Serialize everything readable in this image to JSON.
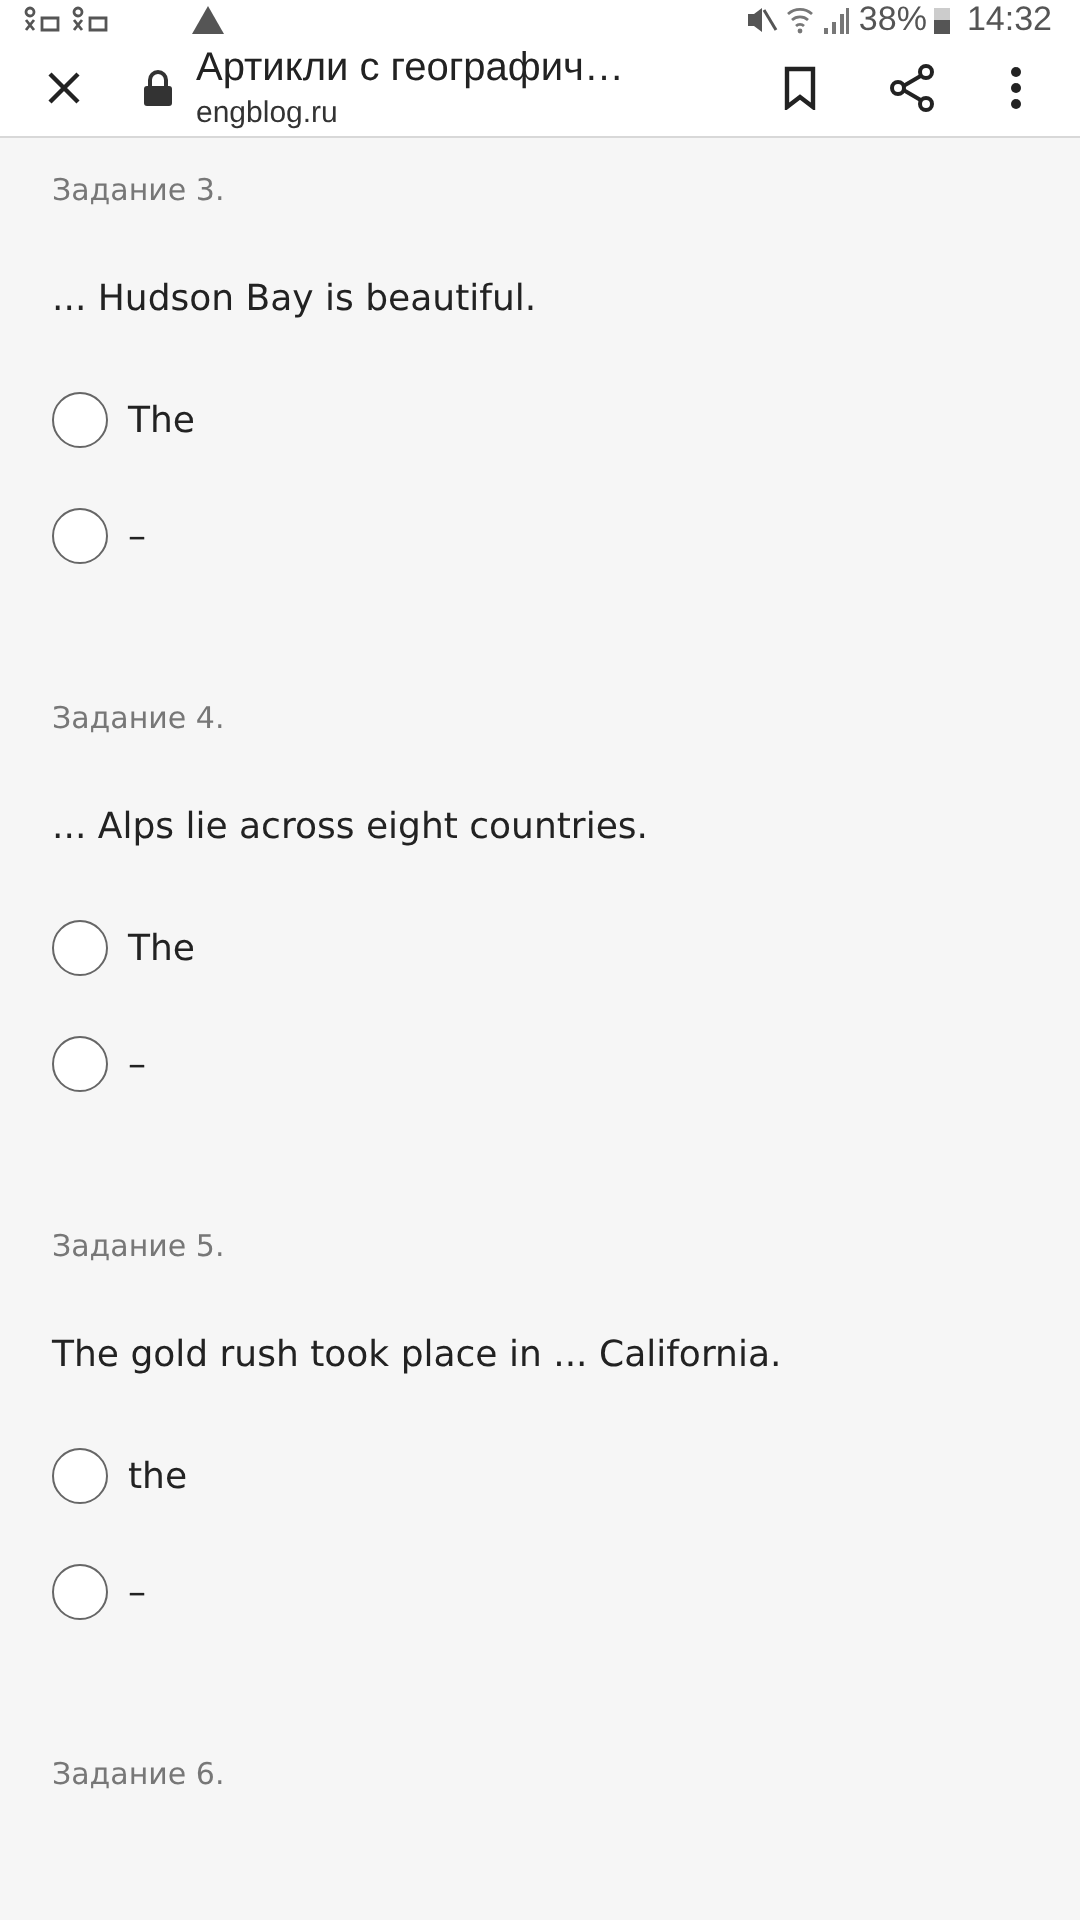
{
  "status_bar": {
    "battery": "38%",
    "time": "14:32"
  },
  "toolbar": {
    "title": "Артикли с географич…",
    "url": "engblog.ru"
  },
  "tasks": [
    {
      "heading": "Задание 3.",
      "question": "... Hudson Bay is beautiful.",
      "options": [
        {
          "label": "The",
          "selected": false
        },
        {
          "label": "–",
          "selected": false
        }
      ]
    },
    {
      "heading": "Задание 4.",
      "question": "... Alps lie across eight countries.",
      "options": [
        {
          "label": "The",
          "selected": false
        },
        {
          "label": "–",
          "selected": false
        }
      ]
    },
    {
      "heading": "Задание 5.",
      "question": "The gold rush took place in ... California.",
      "options": [
        {
          "label": "the",
          "selected": false
        },
        {
          "label": "–",
          "selected": false
        }
      ]
    },
    {
      "heading": "Задание 6."
    }
  ]
}
